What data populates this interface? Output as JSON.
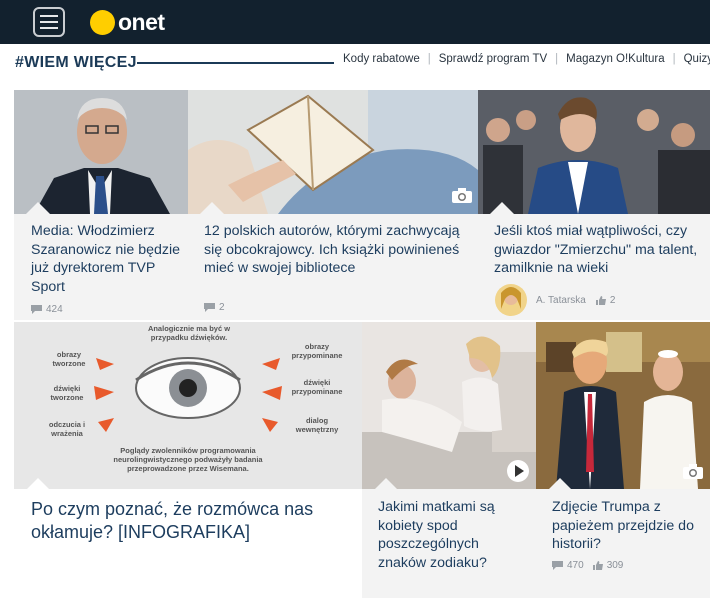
{
  "header": {
    "logo_text": "onet",
    "menu_icon": "hamburger-icon"
  },
  "section": {
    "title": "#WIEM WIĘCEJ",
    "links": [
      "Kody rabatowe",
      "Sprawdź program TV",
      "Magazyn O!Kultura",
      "Quizy"
    ]
  },
  "cards": [
    {
      "title": "Media: Włodzimierz Szaranowicz nie będzie już dyrektorem TVP Sport",
      "comments": "424"
    },
    {
      "title": "12 polskich autorów, którymi zachwycają się obcokrajowcy. Ich książki powinieneś mieć w swojej bibliotece",
      "comments": "2",
      "badge_icon": "camera-icon"
    },
    {
      "title": "Jeśli ktoś miał wątpliwości, czy gwiazdor \"Zmierzchu\" ma talent, zamilknie na wieki",
      "author": "A. Tatarska",
      "likes": "2"
    },
    {
      "title": "Po czym poznać, że rozmówca nas okłamuje? [INFOGRAFIKA]",
      "infographic": {
        "top": "Analogicznie ma być w przypadku dźwięków.",
        "left": [
          "obrazy tworzone",
          "dźwięki tworzone",
          "odczucia i wrażenia"
        ],
        "right": [
          "obrazy przypominane",
          "dźwięki przypominane",
          "dialog wewnętrzny"
        ],
        "bottom": "Poglądy zwolenników programowania neurolingwistycznego podważyły badania przeprowadzone przez Wisemana."
      }
    },
    {
      "title": "Jakimi matkami są kobiety spod poszczególnych znaków zodiaku?",
      "badge_icon": "play-icon"
    },
    {
      "title": "Zdjęcie Trumpa z papieżem przejdzie do historii?",
      "comments": "470",
      "likes": "309",
      "badge_icon": "camera-icon"
    }
  ]
}
